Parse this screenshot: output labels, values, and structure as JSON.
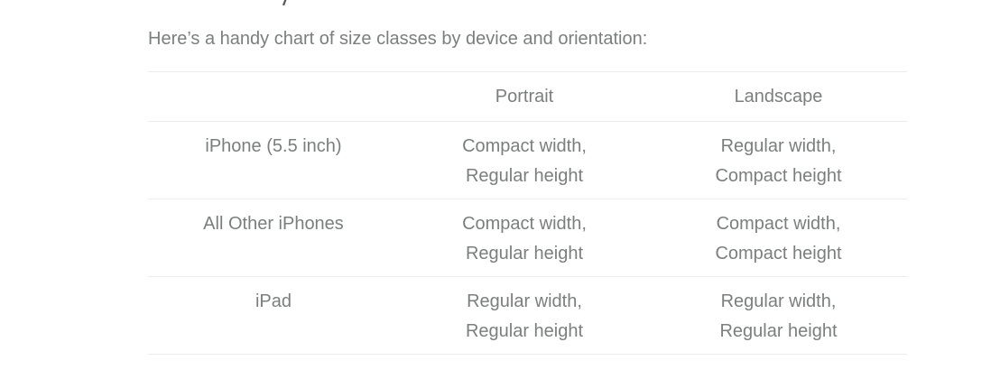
{
  "intro": "Here’s a handy chart of size classes by device and orientation:",
  "table": {
    "headers": [
      "",
      "Portrait",
      "Landscape"
    ],
    "rows": [
      {
        "device": "iPhone (5.5 inch)",
        "portrait": [
          "Compact width,",
          "Regular height"
        ],
        "landscape": [
          "Regular width,",
          "Compact height"
        ]
      },
      {
        "device": "All Other iPhones",
        "portrait": [
          "Compact width,",
          "Regular height"
        ],
        "landscape": [
          "Compact width,",
          "Compact height"
        ]
      },
      {
        "device": "iPad",
        "portrait": [
          "Regular width,",
          "Regular height"
        ],
        "landscape": [
          "Regular width,",
          "Regular height"
        ]
      }
    ]
  },
  "colors": {
    "text": "#7a7f7d",
    "rule": "#ececec",
    "background": "#ffffff"
  }
}
